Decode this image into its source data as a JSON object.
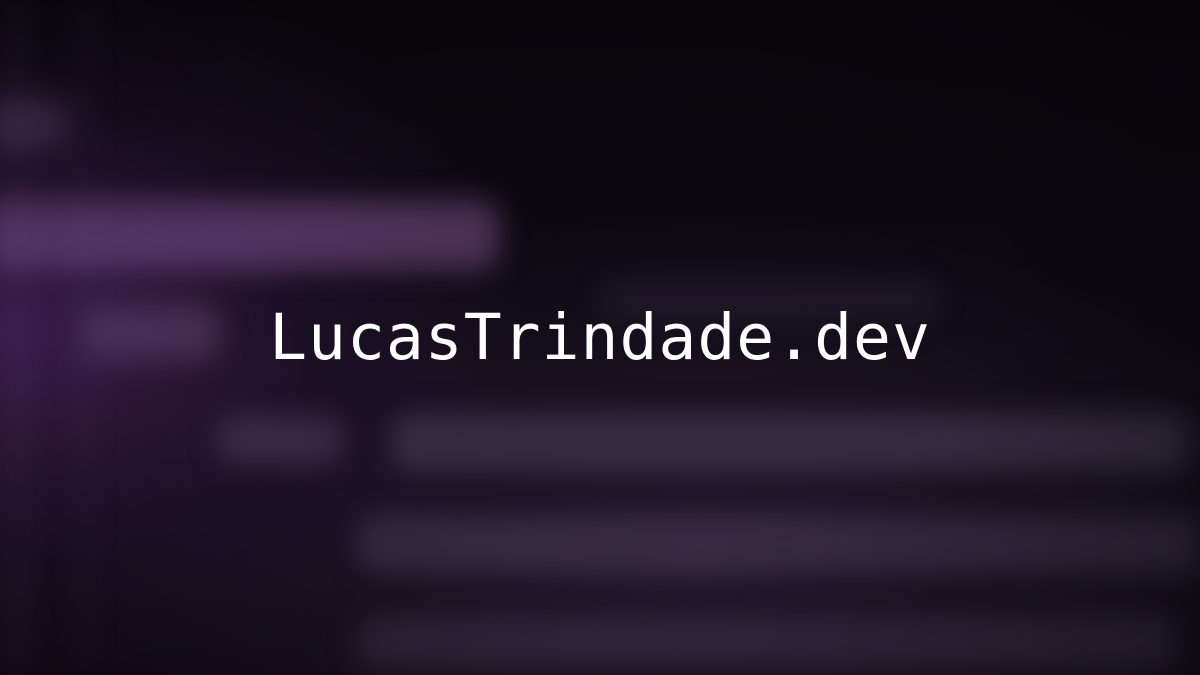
{
  "site": {
    "title": "LucasTrindade.dev"
  },
  "colors": {
    "background": "#0b0710",
    "accent_glow": "#6e348c",
    "title_text": "#ffffff"
  }
}
